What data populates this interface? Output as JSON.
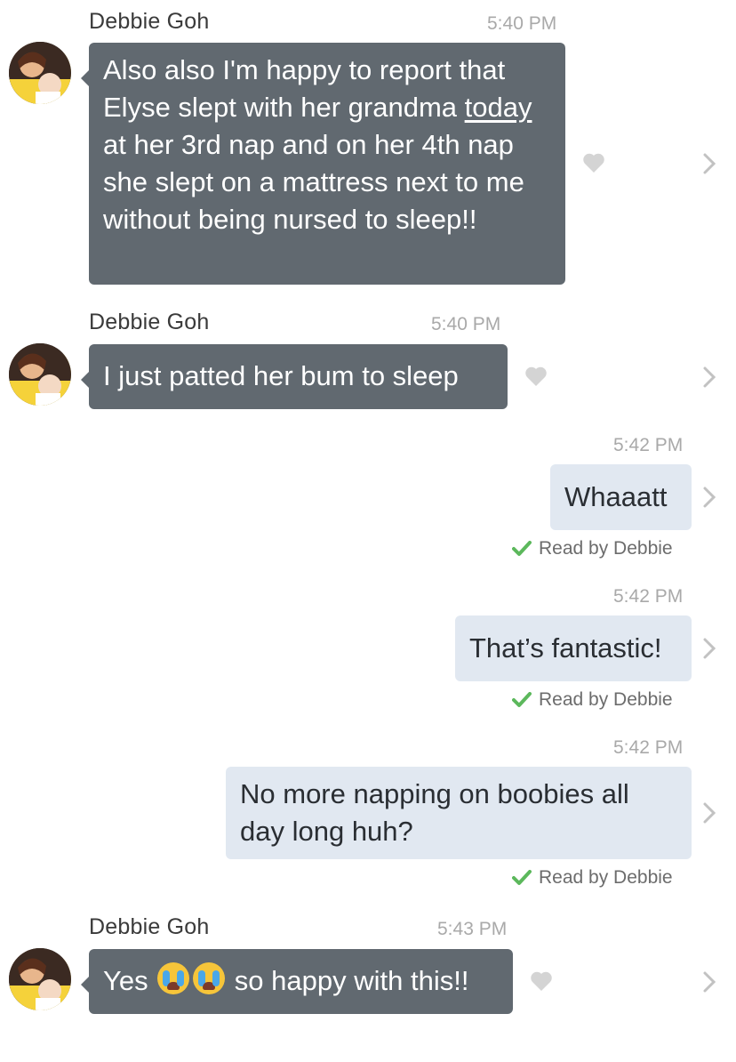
{
  "messages": [
    {
      "sender": "Debbie Goh",
      "time": "5:40 PM",
      "text_before": "Also also I'm happy to report that Elyse slept with her grandma ",
      "text_link": "today",
      "text_after": " at her 3rd nap and on her 4th nap she slept on a mattress next to me without being nursed to sleep!!"
    },
    {
      "sender": "Debbie Goh",
      "time": "5:40 PM",
      "text": "I just patted her bum to sleep"
    },
    {
      "time": "5:42 PM",
      "text": "Whaaatt",
      "read": "Read by Debbie"
    },
    {
      "time": "5:42 PM",
      "text": "That’s fantastic!",
      "read": "Read by Debbie"
    },
    {
      "time": "5:42 PM",
      "text": "No more napping on boobies all day long huh?",
      "read": "Read by Debbie"
    },
    {
      "sender": "Debbie Goh",
      "time": "5:43 PM",
      "text_before": "Yes ",
      "text_after": " so happy with this!!",
      "emoji_name": "loudly-crying-face-emoji"
    }
  ],
  "colors": {
    "incoming_bubble": "#616970",
    "outgoing_bubble": "#e1e8f1",
    "read_check": "#5cb85c",
    "timestamp": "#a9a9a9"
  }
}
